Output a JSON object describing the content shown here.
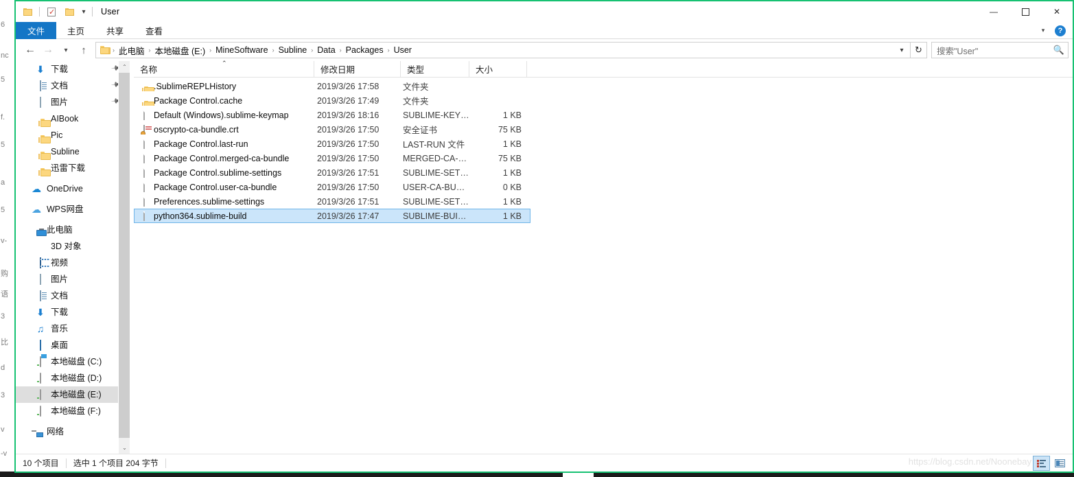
{
  "window": {
    "title": "User",
    "quick_access": [
      {
        "name": "folder-icon",
        "label": ""
      },
      {
        "name": "properties-icon",
        "label": ""
      },
      {
        "name": "new-folder-icon",
        "label": ""
      },
      {
        "name": "chevron-down-icon",
        "label": ""
      }
    ],
    "controls": {
      "minimize": "—",
      "maximize": "☐",
      "close": "✕"
    }
  },
  "ribbon": {
    "tabs": [
      {
        "label": "文件",
        "active": true
      },
      {
        "label": "主页",
        "active": false
      },
      {
        "label": "共享",
        "active": false
      },
      {
        "label": "查看",
        "active": false
      }
    ],
    "collapse_icon": "chevron-down-icon",
    "help_label": "?"
  },
  "address": {
    "back_icon": "←",
    "forward_icon": "→",
    "recent_icon": "⌄",
    "up_icon": "↑",
    "breadcrumbs": [
      "此电脑",
      "本地磁盘 (E:)",
      "MineSoftware",
      "Subline",
      "Data",
      "Packages",
      "User"
    ],
    "separator": "›",
    "dropdown_icon": "⌄",
    "refresh_icon": "↻"
  },
  "search": {
    "placeholder": "搜索\"User\"",
    "value": "",
    "icon": "⌕"
  },
  "sidebar": {
    "items": [
      {
        "label": "下载",
        "icon": "download-icon",
        "indent": 1,
        "pinned": true,
        "selected": false
      },
      {
        "label": "文档",
        "icon": "document-icon",
        "indent": 1,
        "pinned": true,
        "selected": false
      },
      {
        "label": "图片",
        "icon": "pictures-icon",
        "indent": 1,
        "pinned": true,
        "selected": false
      },
      {
        "label": "AIBook",
        "icon": "folder-icon",
        "indent": 1,
        "pinned": false,
        "selected": false
      },
      {
        "label": "Pic",
        "icon": "folder-icon",
        "indent": 1,
        "pinned": false,
        "selected": false
      },
      {
        "label": "Subline",
        "icon": "folder-icon",
        "indent": 1,
        "pinned": false,
        "selected": false
      },
      {
        "label": "迅雷下载",
        "icon": "folder-icon",
        "indent": 1,
        "pinned": false,
        "selected": false
      },
      {
        "label": "OneDrive",
        "icon": "onedrive-icon",
        "indent": 0,
        "pinned": false,
        "selected": false,
        "gap": true
      },
      {
        "label": "WPS网盘",
        "icon": "cloud-icon",
        "indent": 0,
        "pinned": false,
        "selected": false,
        "gap": true
      },
      {
        "label": "此电脑",
        "icon": "this-pc-icon",
        "indent": 0,
        "pinned": false,
        "selected": false,
        "gap": true
      },
      {
        "label": "3D 对象",
        "icon": "3d-objects-icon",
        "indent": 1,
        "pinned": false,
        "selected": false
      },
      {
        "label": "视频",
        "icon": "videos-icon",
        "indent": 1,
        "pinned": false,
        "selected": false
      },
      {
        "label": "图片",
        "icon": "pictures-icon",
        "indent": 1,
        "pinned": false,
        "selected": false
      },
      {
        "label": "文档",
        "icon": "document-icon",
        "indent": 1,
        "pinned": false,
        "selected": false
      },
      {
        "label": "下载",
        "icon": "download-icon",
        "indent": 1,
        "pinned": false,
        "selected": false
      },
      {
        "label": "音乐",
        "icon": "music-icon",
        "indent": 1,
        "pinned": false,
        "selected": false
      },
      {
        "label": "桌面",
        "icon": "desktop-icon",
        "indent": 1,
        "pinned": false,
        "selected": false
      },
      {
        "label": "本地磁盘 (C:)",
        "icon": "system-drive-icon",
        "indent": 1,
        "pinned": false,
        "selected": false
      },
      {
        "label": "本地磁盘 (D:)",
        "icon": "drive-icon",
        "indent": 1,
        "pinned": false,
        "selected": false
      },
      {
        "label": "本地磁盘 (E:)",
        "icon": "drive-icon",
        "indent": 1,
        "pinned": false,
        "selected": true
      },
      {
        "label": "本地磁盘 (F:)",
        "icon": "drive-icon",
        "indent": 1,
        "pinned": false,
        "selected": false
      },
      {
        "label": "网络",
        "icon": "network-icon",
        "indent": 0,
        "pinned": false,
        "selected": false,
        "gap": true
      }
    ],
    "scrollbar": {
      "up_arrow": "⌃",
      "down_arrow": "⌄"
    }
  },
  "filelist": {
    "columns": [
      {
        "label": "名称",
        "key": "name",
        "align": "left"
      },
      {
        "label": "修改日期",
        "key": "date",
        "align": "left"
      },
      {
        "label": "类型",
        "key": "type",
        "align": "left"
      },
      {
        "label": "大小",
        "key": "size",
        "align": "right"
      }
    ],
    "sort": {
      "column": "名称",
      "direction": "asc",
      "glyph": "⌃"
    },
    "rows": [
      {
        "name": ".SublimeREPLHistory",
        "date": "2019/3/26 17:58",
        "type": "文件夹",
        "size": "",
        "icon": "folder-icon",
        "selected": false
      },
      {
        "name": "Package Control.cache",
        "date": "2019/3/26 17:49",
        "type": "文件夹",
        "size": "",
        "icon": "folder-icon",
        "selected": false
      },
      {
        "name": "Default (Windows).sublime-keymap",
        "date": "2019/3/26 18:16",
        "type": "SUBLIME-KEYM...",
        "size": "1 KB",
        "icon": "file-icon",
        "selected": false
      },
      {
        "name": "oscrypto-ca-bundle.crt",
        "date": "2019/3/26 17:50",
        "type": "安全证书",
        "size": "75 KB",
        "icon": "certificate-icon",
        "selected": false
      },
      {
        "name": "Package Control.last-run",
        "date": "2019/3/26 17:50",
        "type": "LAST-RUN 文件",
        "size": "1 KB",
        "icon": "file-icon",
        "selected": false
      },
      {
        "name": "Package Control.merged-ca-bundle",
        "date": "2019/3/26 17:50",
        "type": "MERGED-CA-BU...",
        "size": "75 KB",
        "icon": "file-icon",
        "selected": false
      },
      {
        "name": "Package Control.sublime-settings",
        "date": "2019/3/26 17:51",
        "type": "SUBLIME-SETTI...",
        "size": "1 KB",
        "icon": "file-icon",
        "selected": false
      },
      {
        "name": "Package Control.user-ca-bundle",
        "date": "2019/3/26 17:50",
        "type": "USER-CA-BUND...",
        "size": "0 KB",
        "icon": "file-icon",
        "selected": false
      },
      {
        "name": "Preferences.sublime-settings",
        "date": "2019/3/26 17:51",
        "type": "SUBLIME-SETTI...",
        "size": "1 KB",
        "icon": "file-icon",
        "selected": false
      },
      {
        "name": "python364.sublime-build",
        "date": "2019/3/26 17:47",
        "type": "SUBLIME-BUILD...",
        "size": "1 KB",
        "icon": "file-icon",
        "selected": true
      }
    ]
  },
  "statusbar": {
    "item_count": "10 个项目",
    "selection": "选中 1 个项目  204 字节",
    "watermark": "https://blog.csdn.net/Noonebay",
    "views": [
      {
        "name": "details-view-button",
        "active": true
      },
      {
        "name": "large-icons-view-button",
        "active": false
      }
    ]
  },
  "background_strip": {
    "lines": [
      "6",
      "nc",
      "5",
      "f.",
      "5",
      "a",
      "5",
      "v-",
      "购",
      "语",
      "3",
      "比",
      "d",
      "3",
      "v",
      "-v"
    ]
  },
  "colors": {
    "accent": "#1476c6",
    "selection": "#cbe5fa",
    "selection_border": "#6fb4e8",
    "nav_selection": "#dedede",
    "window_border": "#16c172",
    "folder": "#fcd77f"
  }
}
